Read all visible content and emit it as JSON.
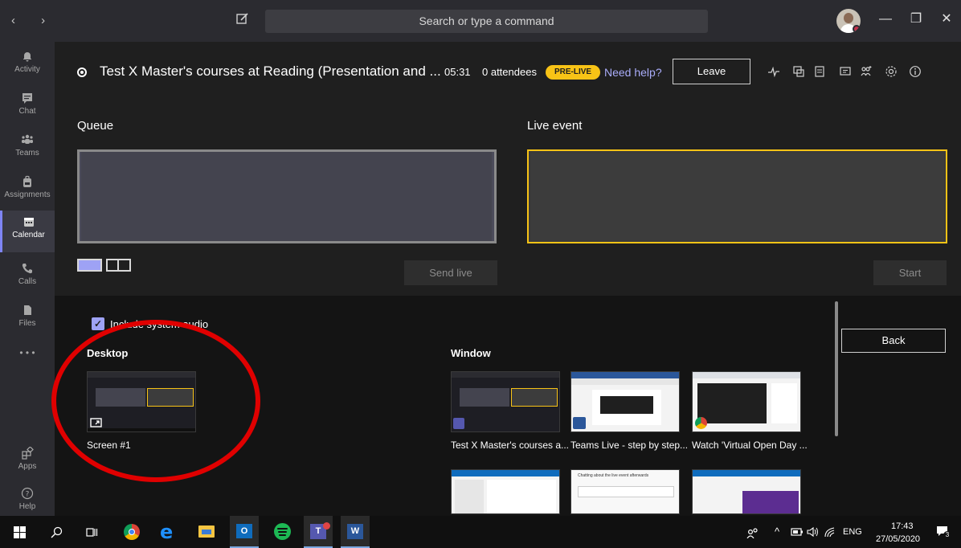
{
  "titlebar": {
    "nav": "‹ ›",
    "search_placeholder": "Search or type a command",
    "minimize": "—",
    "restore": "❐",
    "close": "✕"
  },
  "rail": [
    {
      "label": "Activity",
      "icon": "bell-icon"
    },
    {
      "label": "Chat",
      "icon": "chat-icon"
    },
    {
      "label": "Teams",
      "icon": "teams-icon"
    },
    {
      "label": "Assignments",
      "icon": "backpack-icon"
    },
    {
      "label": "Calendar",
      "icon": "calendar-icon",
      "active": true
    },
    {
      "label": "Calls",
      "icon": "phone-icon"
    },
    {
      "label": "Files",
      "icon": "file-icon"
    },
    {
      "label": "• • •",
      "icon": "more-icon"
    },
    {
      "label": "Apps",
      "icon": "apps-icon"
    },
    {
      "label": "Help",
      "icon": "help-icon"
    }
  ],
  "event": {
    "title": "Test X Master's courses at Reading (Presentation and ...",
    "time": "05:31",
    "attendees": "0 attendees",
    "status": "PRE-LIVE",
    "help": "Need help?",
    "leave": "Leave"
  },
  "queue": {
    "title": "Queue",
    "send_live": "Send live"
  },
  "live": {
    "title": "Live event",
    "start": "Start"
  },
  "share": {
    "include_audio": "Include system audio",
    "desktop_title": "Desktop",
    "window_title": "Window",
    "back": "Back",
    "desktop_items": [
      {
        "caption": "Screen #1"
      }
    ],
    "window_items": [
      {
        "caption": "Test X Master's courses a...",
        "app": "teams"
      },
      {
        "caption": "Teams Live - step by step...",
        "app": "word"
      },
      {
        "caption": "Watch 'Virtual Open Day ...",
        "app": "chrome"
      }
    ],
    "window_row2_text": "Chatting about the live event afterwards"
  },
  "taskbar": {
    "time": "17:43",
    "date": "27/05/2020",
    "lang": "ENG",
    "notifications": "3"
  },
  "colors": {
    "accent": "#7f85f5",
    "prelive": "#f8c316",
    "annotation": "#e00000"
  }
}
